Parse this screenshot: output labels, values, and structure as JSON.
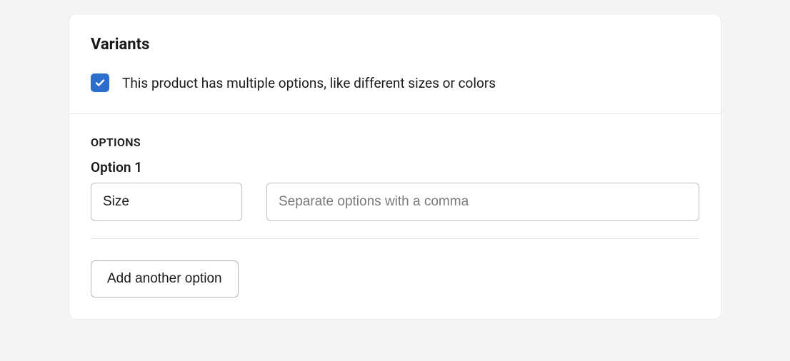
{
  "card": {
    "title": "Variants",
    "checkbox": {
      "checked": true,
      "label": "This product has multiple options, like different sizes or colors"
    },
    "options": {
      "heading": "OPTIONS",
      "items": [
        {
          "label": "Option 1",
          "name_value": "Size",
          "values_placeholder": "Separate options with a comma"
        }
      ],
      "add_button_label": "Add another option"
    }
  }
}
